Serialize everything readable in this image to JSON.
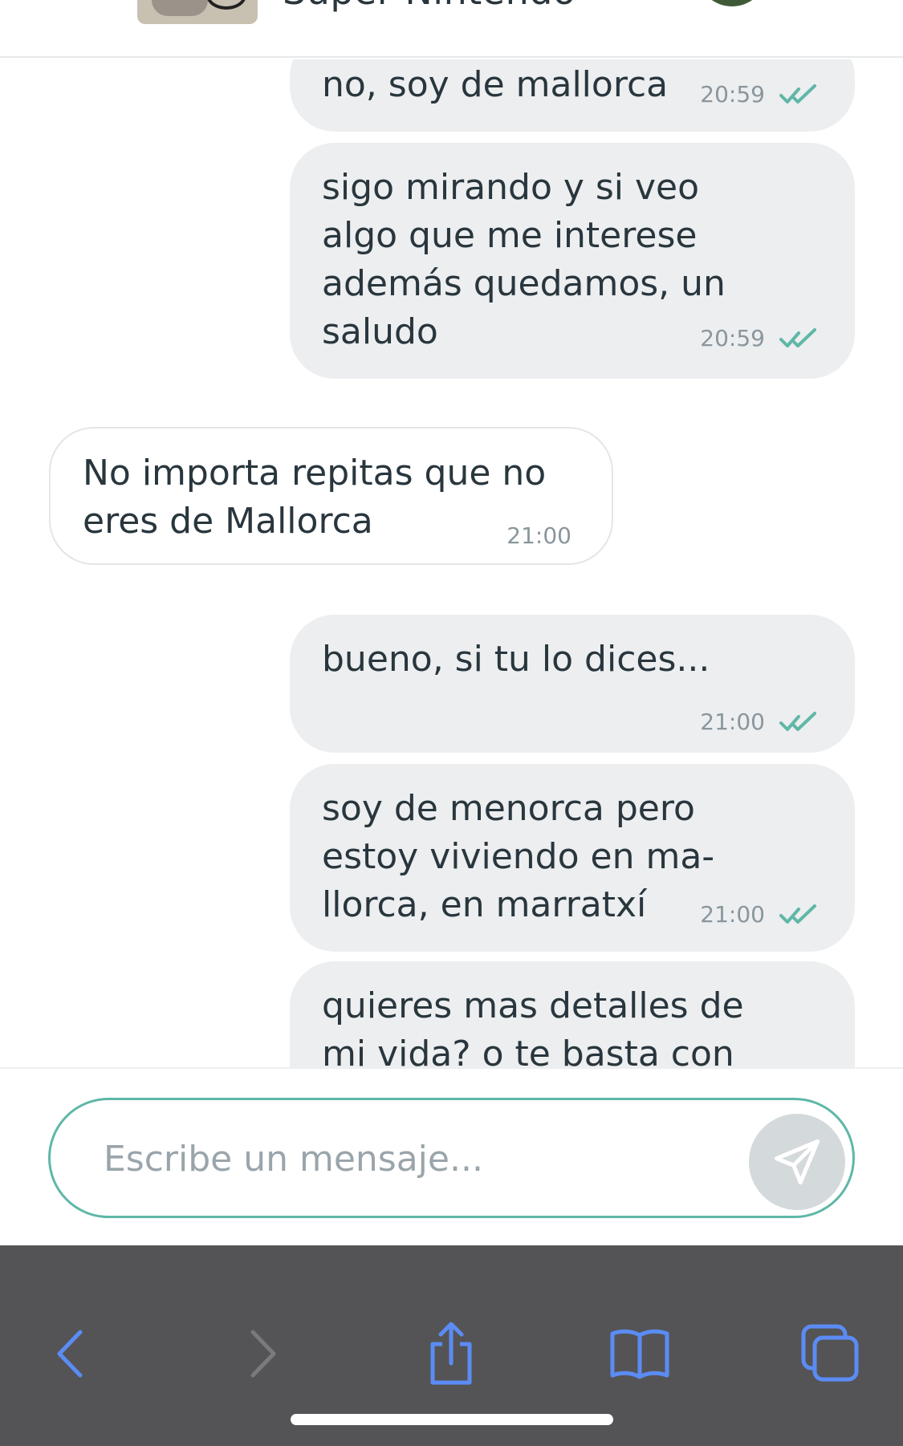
{
  "header": {
    "title": "Super Nintendo"
  },
  "messages": [
    {
      "direction": "out",
      "lines": [
        "no, soy de mallorca"
      ],
      "time": "20:59",
      "status": "read"
    },
    {
      "direction": "out",
      "lines": [
        "sigo mirando y si veo",
        "algo que me interese",
        "además quedamos, un",
        "saludo"
      ],
      "time": "20:59",
      "status": "read"
    },
    {
      "direction": "in",
      "lines": [
        "No importa repitas que no",
        "eres de Mallorca"
      ],
      "time": "21:00"
    },
    {
      "direction": "out",
      "lines": [
        "bueno, si tu lo dices..."
      ],
      "time": "21:00",
      "status": "read"
    },
    {
      "direction": "out",
      "lines": [
        "soy de menorca pero",
        "estoy viviendo en ma-",
        "llorca, en marratxí"
      ],
      "time": "21:00",
      "status": "read"
    },
    {
      "direction": "out",
      "lines": [
        "quieres mas detalles de",
        "mi vida? o te basta con"
      ]
    }
  ],
  "composer": {
    "placeholder": "Escribe un mensaje...",
    "value": ""
  },
  "toolbar": {
    "icons": [
      "back-icon",
      "forward-icon",
      "share-icon",
      "bookmarks-icon",
      "tabs-icon"
    ]
  },
  "colors": {
    "accent": "#5fb7a7",
    "outgoing_bubble": "#eceef0",
    "incoming_border": "#e3e6e8",
    "timestamp": "#8a969d",
    "toolbar_bg": "#545456",
    "toolbar_icon": "#5b8cf5",
    "toolbar_icon_disabled": "#7a7a7c"
  }
}
